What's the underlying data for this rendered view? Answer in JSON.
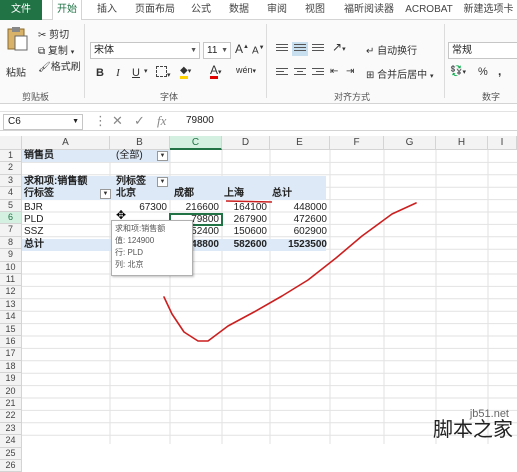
{
  "tabs": [
    "文件",
    "开始",
    "插入",
    "页面布局",
    "公式",
    "数据",
    "审阅",
    "视图",
    "福昕阅读器",
    "ACROBAT",
    "新建选项卡"
  ],
  "ribbon": {
    "clipboard": {
      "paste": "粘贴",
      "cut": "剪切",
      "copy": "复制",
      "format_painter": "格式刷",
      "label": "剪贴板"
    },
    "font": {
      "name": "宋体",
      "size": "11",
      "label": "字体",
      "bold": "B",
      "italic": "I",
      "underline": "U",
      "grow": "A",
      "shrink": "A",
      "font_color": "A",
      "phonetic": "wén"
    },
    "alignment": {
      "wrap": "自动换行",
      "merge": "合并后居中",
      "label": "对齐方式"
    },
    "number": {
      "format": "常规",
      "label": "数字",
      "percent": "%",
      "comma": ","
    }
  },
  "formula": {
    "namebox": "C6",
    "value": "79800",
    "fx": "fx"
  },
  "columns": [
    "A",
    "B",
    "C",
    "D",
    "E",
    "F",
    "G",
    "H",
    "I"
  ],
  "rows": [
    "1",
    "2",
    "3",
    "4",
    "5",
    "6",
    "7",
    "8",
    "9",
    "10",
    "11",
    "12",
    "13",
    "14",
    "15",
    "16",
    "17",
    "18",
    "19",
    "20",
    "21",
    "22",
    "23",
    "24",
    "25",
    "26"
  ],
  "pivot": {
    "filter_label": "销售员",
    "filter_value": "(全部)",
    "sum_label": "求和项:销售额",
    "col_label": "列标签",
    "row_label": "行标签",
    "headers": [
      "北京",
      "成都",
      "上海",
      "总计"
    ],
    "data": [
      {
        "name": "BJR",
        "values": [
          "67300",
          "216600",
          "164100",
          "448000"
        ]
      },
      {
        "name": "PLD",
        "values": [
          "",
          "79800",
          "267900",
          "472600"
        ]
      },
      {
        "name": "SSZ",
        "values": [
          "",
          "252400",
          "150600",
          "602900"
        ]
      }
    ],
    "total_label": "总计",
    "totals": [
      "",
      "548800",
      "582600",
      "1523500"
    ]
  },
  "tooltip": {
    "line1": "求和项:销售额",
    "line2": "值: 124900",
    "line3": "行: PLD",
    "line4": "列: 北京"
  },
  "watermark": {
    "site": "jb51.net",
    "name": "脚本之家"
  },
  "colors": {
    "accent": "#217346",
    "pivot_header": "#dde9f7",
    "annotation": "#cc1f1f"
  }
}
